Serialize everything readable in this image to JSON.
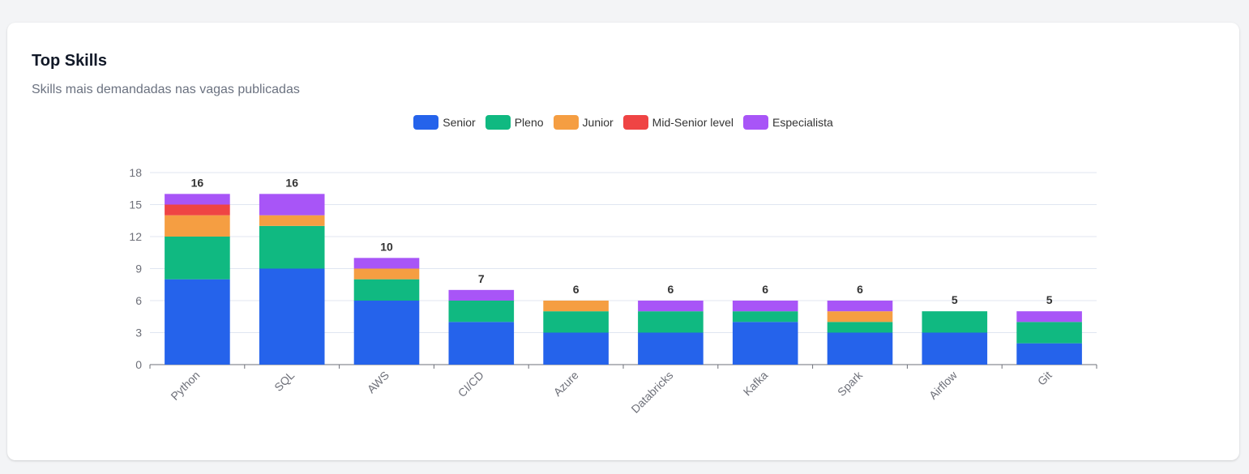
{
  "card": {
    "title": "Top Skills",
    "subtitle": "Skills mais demandadas nas vagas publicadas"
  },
  "chart_data": {
    "type": "bar",
    "stacked": true,
    "categories": [
      "Python",
      "SQL",
      "AWS",
      "CI/CD",
      "Azure",
      "Databricks",
      "Kafka",
      "Spark",
      "Airflow",
      "Git"
    ],
    "series": [
      {
        "name": "Senior",
        "color": "#2563eb",
        "values": [
          8,
          9,
          6,
          4,
          3,
          3,
          4,
          3,
          3,
          2
        ]
      },
      {
        "name": "Pleno",
        "color": "#10b981",
        "values": [
          4,
          4,
          2,
          2,
          2,
          2,
          1,
          1,
          2,
          2
        ]
      },
      {
        "name": "Junior",
        "color": "#f59e42",
        "values": [
          2,
          1,
          1,
          0,
          1,
          0,
          0,
          1,
          0,
          0
        ]
      },
      {
        "name": "Mid-Senior level",
        "color": "#ef4444",
        "values": [
          1,
          0,
          0,
          0,
          0,
          0,
          0,
          0,
          0,
          0
        ]
      },
      {
        "name": "Especialista",
        "color": "#a855f7",
        "values": [
          1,
          2,
          1,
          1,
          0,
          1,
          1,
          1,
          0,
          1
        ]
      }
    ],
    "totals": [
      16,
      16,
      10,
      7,
      6,
      6,
      6,
      6,
      5,
      5
    ],
    "yticks": [
      0,
      3,
      6,
      9,
      12,
      15,
      18
    ],
    "ylim": [
      0,
      18
    ],
    "grid": true,
    "legend_position": "top-center",
    "xlabel": "",
    "ylabel": ""
  }
}
